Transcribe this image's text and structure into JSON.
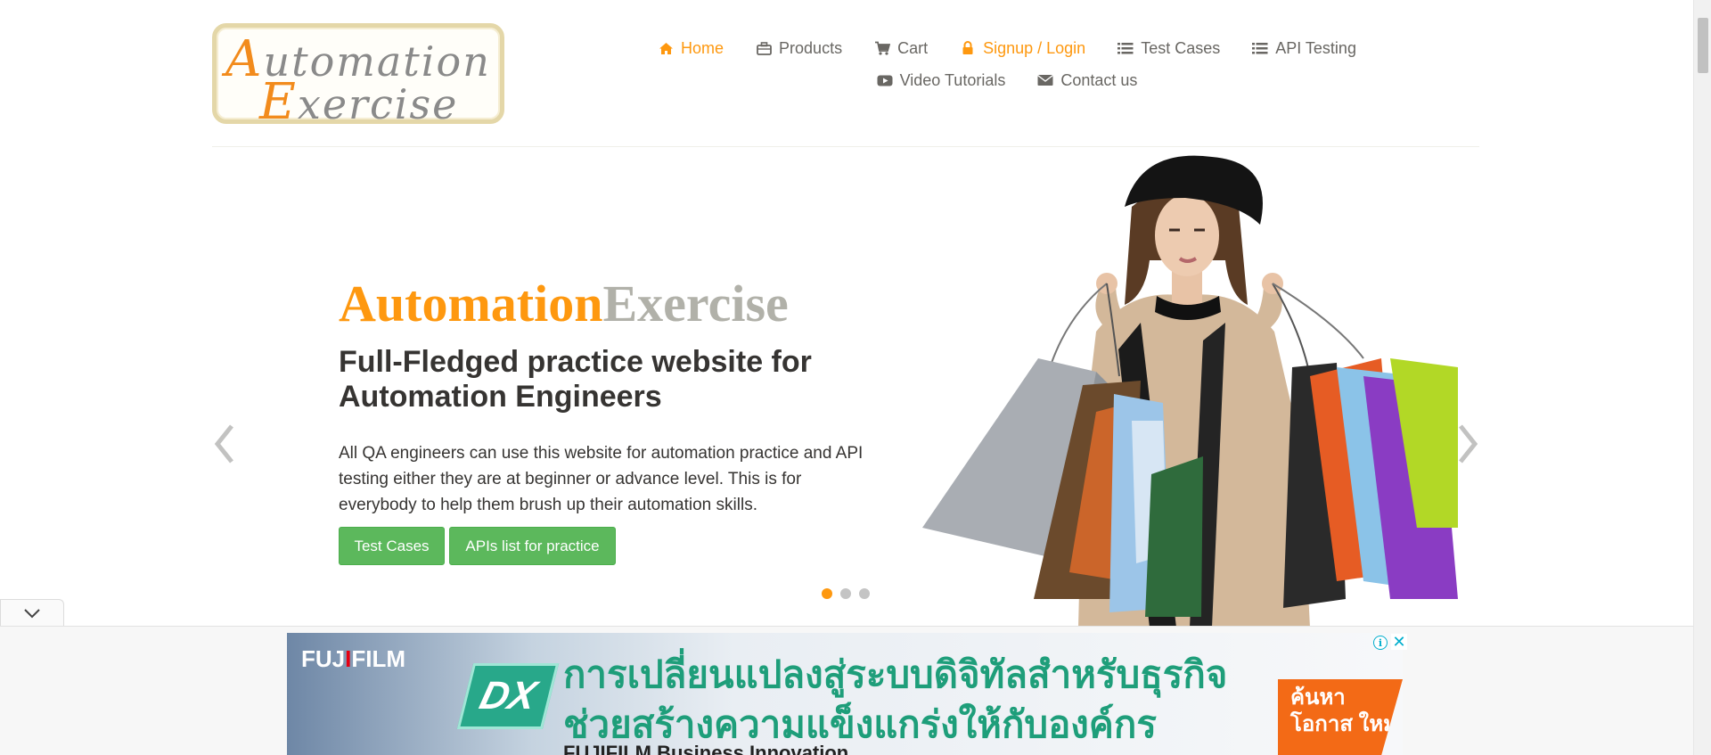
{
  "logo": {
    "word1_cap": "A",
    "word1_rest": "utomation",
    "word2_cap": "E",
    "word2_rest": "xercise"
  },
  "nav": {
    "row1": [
      {
        "label": "Home",
        "icon": "home-icon",
        "state": "active"
      },
      {
        "label": "Products",
        "icon": "briefcase-icon"
      },
      {
        "label": "Cart",
        "icon": "cart-icon"
      },
      {
        "label": "Signup / Login",
        "icon": "lock-icon"
      },
      {
        "label": "Test Cases",
        "icon": "list-icon"
      },
      {
        "label": "API Testing",
        "icon": "list-icon"
      }
    ],
    "row2": [
      {
        "label": "Video Tutorials",
        "icon": "youtube-play-icon"
      },
      {
        "label": "Contact us",
        "icon": "envelope-icon"
      }
    ]
  },
  "hero": {
    "title_part1": "Automation",
    "title_part2": "Exercise",
    "subtitle": "Full-Fledged practice website for Automation Engineers",
    "description": "All QA engineers can use this website for automation practice and API testing either they are at beginner or advance level. This is for everybody to help them brush up their automation skills.",
    "button_test_cases": "Test Cases",
    "button_apis": "APIs list for practice",
    "slide_count": 3,
    "active_slide": 1
  },
  "ad": {
    "brand_pre": "FUJ",
    "brand_i": "I",
    "brand_post": "FILM",
    "badge": "DX",
    "line1": "การเปลี่ยนแปลงสู่ระบบดิจิทัลสำหรับธุรกิจ",
    "line2": "ช่วยสร้างความแข็งแกร่งให้กับองค์กร",
    "line3": "FUJIFILM Business Innovation",
    "cta": "ค้นหา โอกาส ใหม่",
    "info_glyph": "i",
    "close_glyph": "✕"
  },
  "colors": {
    "accent": "#fe980f",
    "button_green": "#5cb85c",
    "text_dark": "#363432",
    "text_muted": "#696763"
  }
}
